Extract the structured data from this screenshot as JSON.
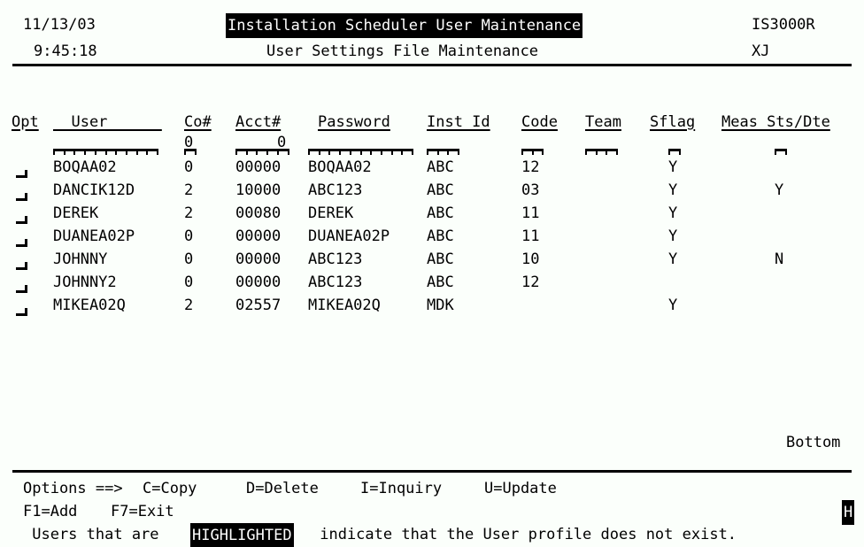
{
  "screen": {
    "background": "#fbfffb",
    "foreground": "#000000",
    "rows": 24,
    "cols": 80
  },
  "header": {
    "date": "11/13/03",
    "time": "9:45:18",
    "title": "Installation Scheduler User Maintenance",
    "subtitle": "User Settings File Maintenance",
    "program_id": "IS3000R",
    "terminal_id": "XJ",
    "title_highlighted": true
  },
  "table": {
    "columns": [
      {
        "key": "opt",
        "label": "Opt",
        "header_underline": "Opt"
      },
      {
        "key": "user",
        "label": "User",
        "header_underline": "  User      "
      },
      {
        "key": "co",
        "label": "Co#",
        "header_underline": "Co#"
      },
      {
        "key": "acct",
        "label": "Acct#",
        "header_underline": "Acct#"
      },
      {
        "key": "password",
        "label": "Password",
        "header_underline": "Password"
      },
      {
        "key": "inst_id",
        "label": "Inst Id",
        "header_underline": "Inst Id"
      },
      {
        "key": "code",
        "label": "Code",
        "header_underline": "Code"
      },
      {
        "key": "team",
        "label": "Team",
        "header_underline": "Team"
      },
      {
        "key": "sflag",
        "label": "Sflag",
        "header_underline": "Sflag"
      },
      {
        "key": "meas",
        "label": "Meas Sts/Dte",
        "header_underline": "Meas Sts/Dte"
      }
    ],
    "filter_row": {
      "user": "",
      "co": "0",
      "acct": "0",
      "password": "",
      "inst_id": "",
      "code": "",
      "team": "",
      "sflag": "",
      "meas": ""
    },
    "rows": [
      {
        "opt": "",
        "user": "BOQAA02",
        "co": "0",
        "acct": "00000",
        "password": "BOQAA02",
        "inst_id": "ABC",
        "code": "12",
        "team": "",
        "sflag": "Y",
        "meas": ""
      },
      {
        "opt": "",
        "user": "DANCIK12D",
        "co": "2",
        "acct": "10000",
        "password": "ABC123",
        "inst_id": "ABC",
        "code": "03",
        "team": "",
        "sflag": "Y",
        "meas": "Y"
      },
      {
        "opt": "",
        "user": "DEREK",
        "co": "2",
        "acct": "00080",
        "password": "DEREK",
        "inst_id": "ABC",
        "code": "11",
        "team": "",
        "sflag": "Y",
        "meas": ""
      },
      {
        "opt": "",
        "user": "DUANEA02P",
        "co": "0",
        "acct": "00000",
        "password": "DUANEA02P",
        "inst_id": "ABC",
        "code": "11",
        "team": "",
        "sflag": "Y",
        "meas": ""
      },
      {
        "opt": "",
        "user": "JOHNNY",
        "co": "0",
        "acct": "00000",
        "password": "ABC123",
        "inst_id": "ABC",
        "code": "10",
        "team": "",
        "sflag": "Y",
        "meas": "N"
      },
      {
        "opt": "",
        "user": "JOHNNY2",
        "co": "0",
        "acct": "00000",
        "password": "ABC123",
        "inst_id": "ABC",
        "code": "12",
        "team": "",
        "sflag": "",
        "meas": ""
      },
      {
        "opt": "",
        "user": "MIKEA02Q",
        "co": "2",
        "acct": "02557",
        "password": "MIKEA02Q",
        "inst_id": "MDK",
        "code": "",
        "team": "",
        "sflag": "Y",
        "meas": ""
      }
    ]
  },
  "status": {
    "position": "Bottom"
  },
  "footer": {
    "options_prompt": "Options ==>",
    "options": [
      {
        "key": "C",
        "label": "C=Copy"
      },
      {
        "key": "D",
        "label": "D=Delete"
      },
      {
        "key": "I",
        "label": "I=Inquiry"
      },
      {
        "key": "U",
        "label": "U=Update"
      }
    ],
    "fkeys": [
      {
        "key": "F1",
        "label": "F1=Add"
      },
      {
        "key": "F7",
        "label": "F7=Exit"
      }
    ],
    "indicator": "H",
    "note_before": " Users that are ",
    "note_highlight": "HIGHLIGHTED",
    "note_after": " indicate that the User profile does not exist."
  }
}
